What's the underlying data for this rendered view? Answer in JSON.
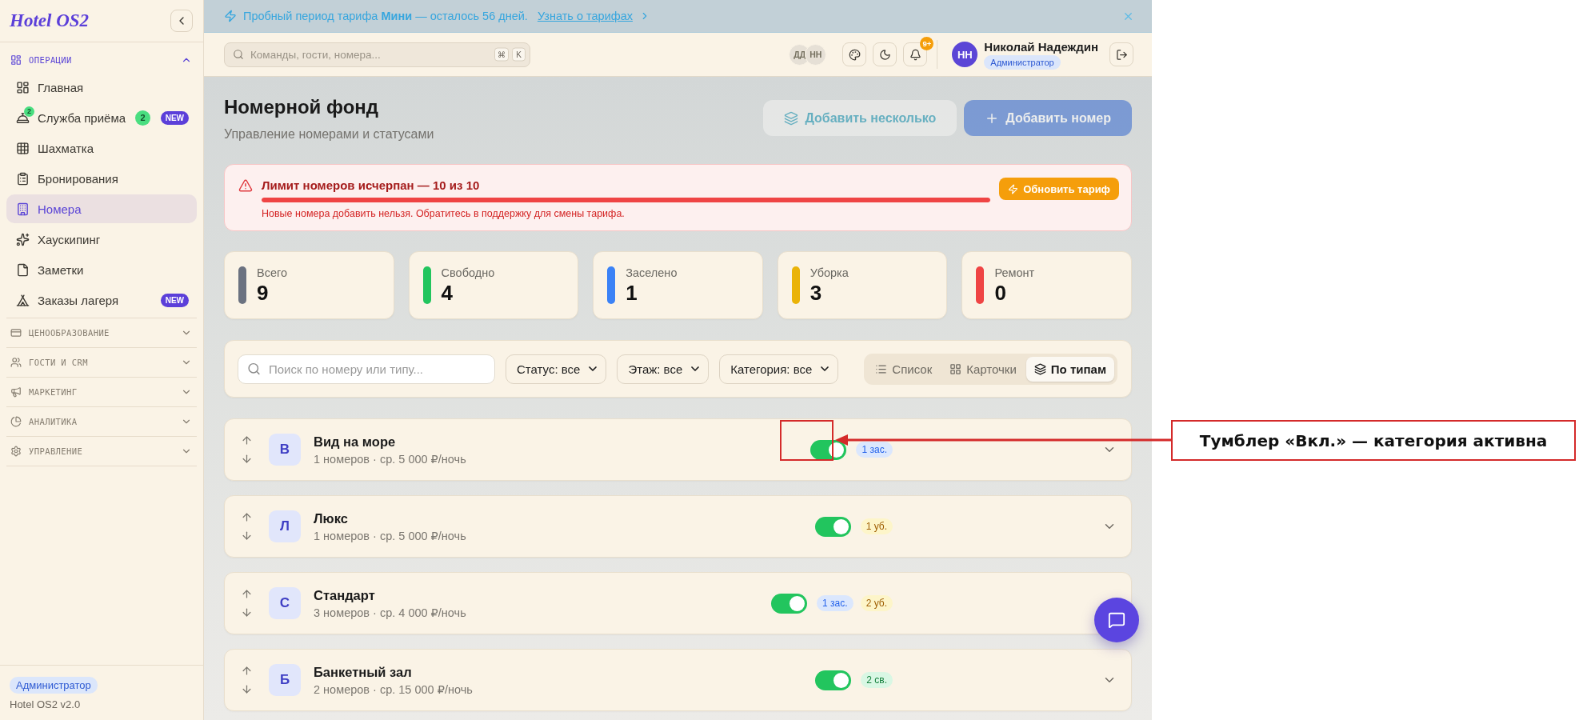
{
  "sidebar": {
    "logo": "Hotel OS2",
    "groups": [
      {
        "title": "ОПЕРАЦИИ",
        "expanded": true,
        "items": [
          {
            "label": "Главная",
            "selected": false
          },
          {
            "label": "Служба приёма",
            "selected": false,
            "icon_badge": "2",
            "count": "2",
            "tag": "NEW"
          },
          {
            "label": "Шахматка",
            "selected": false
          },
          {
            "label": "Бронирования",
            "selected": false
          },
          {
            "label": "Номера",
            "selected": true
          },
          {
            "label": "Хаускипинг",
            "selected": false
          },
          {
            "label": "Заметки",
            "selected": false
          },
          {
            "label": "Заказы лагеря",
            "selected": false,
            "tag": "NEW"
          }
        ]
      },
      {
        "title": "ЦЕНООБРАЗОВАНИЕ",
        "expanded": false
      },
      {
        "title": "ГОСТИ И CRM",
        "expanded": false
      },
      {
        "title": "МАРКЕТИНГ",
        "expanded": false
      },
      {
        "title": "АНАЛИТИКА",
        "expanded": false
      },
      {
        "title": "УПРАВЛЕНИЕ",
        "expanded": false
      }
    ],
    "footer": {
      "role": "Администратор",
      "version": "Hotel OS2 v2.0"
    }
  },
  "banner": {
    "text": "Пробный период тарифа **Мини** — осталось 56 дней.",
    "link": "Узнать о тарифах"
  },
  "topbar": {
    "search": {
      "placeholder": "Команды, гости, номера...",
      "keys": [
        "⌘",
        "K"
      ]
    },
    "online_users": [
      "ДД",
      "НН"
    ],
    "notifications": "9+",
    "user": {
      "initials": "НН",
      "name": "Николай Надеждин",
      "role": "Администратор"
    }
  },
  "header": {
    "title": "Номерной фонд",
    "subtitle": "Управление номерами и статусами",
    "actions": [
      {
        "label": "Добавить несколько",
        "kind": "secondary",
        "disabled": true
      },
      {
        "label": "Добавить номер",
        "kind": "primary",
        "disabled": true
      }
    ]
  },
  "limit_alert": {
    "title": "Лимит номеров исчерпан — 10 из 10",
    "level": 1,
    "message": "Новые номера добавить нельзя. Обратитесь в поддержку для смены тарифа.",
    "action": "Обновить тариф"
  },
  "stats": [
    {
      "label": "Всего",
      "value": "9",
      "color": "#6b7280"
    },
    {
      "label": "Свободно",
      "value": "4",
      "color": "#22c55e"
    },
    {
      "label": "Заселено",
      "value": "1",
      "color": "#3b82f6"
    },
    {
      "label": "Уборка",
      "value": "3",
      "color": "#eab308"
    },
    {
      "label": "Ремонт",
      "value": "0",
      "color": "#ef4444"
    }
  ],
  "filters": {
    "search_placeholder": "Поиск по номеру или типу...",
    "selects": [
      "Статус: все",
      "Этаж: все",
      "Категория: все"
    ],
    "views": [
      {
        "label": "Список",
        "selected": false
      },
      {
        "label": "Карточки",
        "selected": false
      },
      {
        "label": "По типам",
        "selected": true
      }
    ]
  },
  "categories": [
    {
      "letter": "В",
      "name": "Вид на море",
      "summary": "1 номеров · ср. 5 000 ₽/ночь",
      "on": true,
      "badges": [
        {
          "text": "1 зас.",
          "kind": "occupied"
        }
      ]
    },
    {
      "letter": "Л",
      "name": "Люкс",
      "summary": "1 номеров · ср. 5 000 ₽/ночь",
      "on": true,
      "badges": [
        {
          "text": "1 уб.",
          "kind": "cleaning"
        }
      ]
    },
    {
      "letter": "С",
      "name": "Стандарт",
      "summary": "3 номеров · ср. 4 000 ₽/ночь",
      "on": true,
      "badges": [
        {
          "text": "1 зас.",
          "kind": "occupied"
        },
        {
          "text": "2 уб.",
          "kind": "cleaning"
        }
      ]
    },
    {
      "letter": "Б",
      "name": "Банкетный зал",
      "summary": "2 номеров · ср. 15 000 ₽/ночь",
      "on": true,
      "badges": [
        {
          "text": "2 св.",
          "kind": "free"
        }
      ]
    }
  ],
  "annotation": {
    "text": "Тумблер «Вкл.» — категория активна"
  }
}
